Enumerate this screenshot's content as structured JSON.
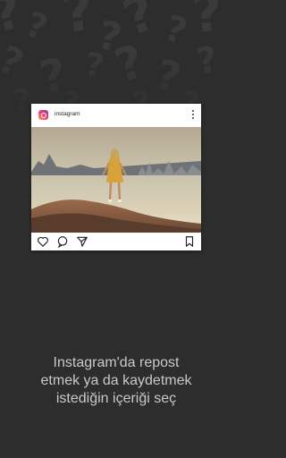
{
  "post": {
    "account_label": "instagram",
    "logo_icon": "instagram-logo-icon",
    "more_icon": "more-vertical-icon",
    "actions": [
      "heart-icon",
      "comment-icon",
      "share-icon",
      "bookmark-icon"
    ]
  },
  "caption": {
    "line1": "Instagram'da repost",
    "line2": "etmek ya da kaydetmek",
    "line3": "istediğin içeriği seç"
  },
  "colors": {
    "background": "#2d2d2d",
    "caption_text": "#c9c9c9",
    "card": "#ffffff"
  }
}
